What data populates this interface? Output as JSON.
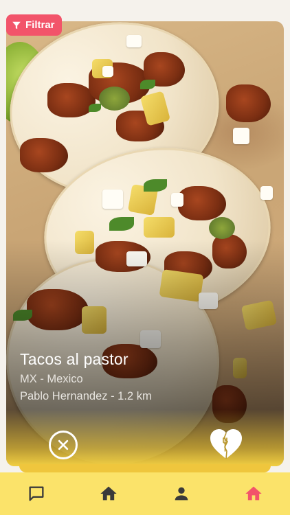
{
  "filter": {
    "label": "Filtrar",
    "icon": "filter-icon"
  },
  "dish": {
    "name": "Tacos al pastor",
    "country": "MX - Mexico",
    "cook_distance": "Pablo Hernandez - 1.2 km"
  },
  "actions": {
    "reject_icon": "close-circle-icon",
    "like_icon": "heart-fork-icon"
  },
  "nav": {
    "items": [
      {
        "name": "chat",
        "icon": "chat-icon"
      },
      {
        "name": "home",
        "icon": "home-icon"
      },
      {
        "name": "profile",
        "icon": "person-icon"
      },
      {
        "name": "home-active",
        "icon": "home-icon",
        "active": true
      }
    ]
  },
  "colors": {
    "accent": "#f2546a",
    "nav_background": "#fbe36a",
    "nav_icon": "#3a3a3a",
    "nav_icon_active": "#f2546a"
  }
}
